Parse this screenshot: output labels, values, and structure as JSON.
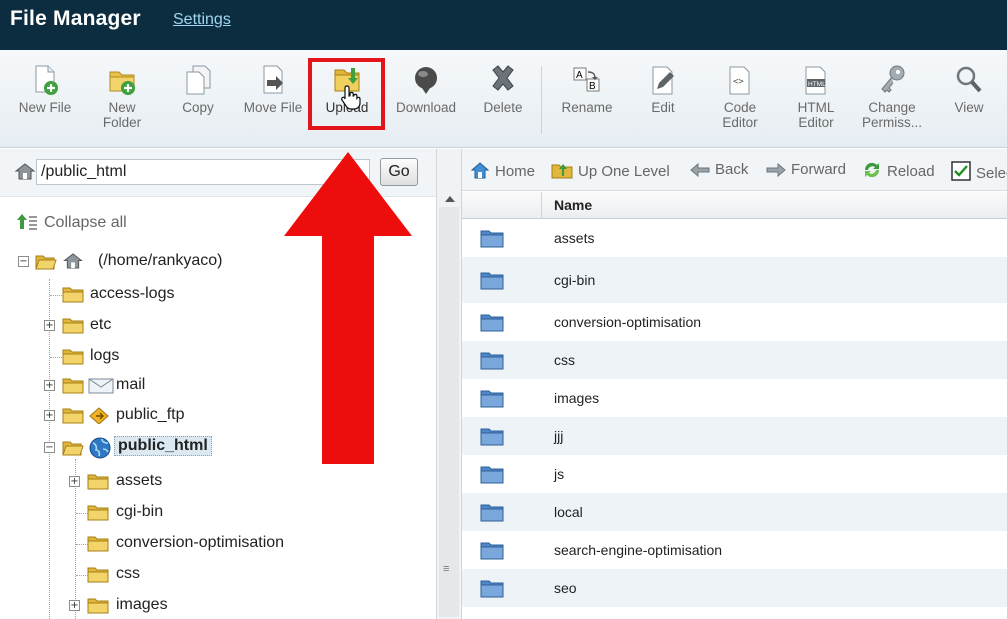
{
  "header": {
    "title": "File Manager",
    "settings_label": "Settings"
  },
  "toolbar": {
    "new_file": [
      "New File"
    ],
    "new_folder": [
      "New",
      "Folder"
    ],
    "copy": [
      "Copy"
    ],
    "move_file": [
      "Move File"
    ],
    "upload": [
      "Upload"
    ],
    "download": [
      "Download"
    ],
    "delete": [
      "Delete"
    ],
    "rename": [
      "Rename"
    ],
    "edit": [
      "Edit"
    ],
    "code_editor": [
      "Code",
      "Editor"
    ],
    "html_editor": [
      "HTML",
      "Editor"
    ],
    "change_permissions": [
      "Change",
      "Permiss..."
    ],
    "view": [
      "View"
    ]
  },
  "path_bar": {
    "value": "/public_html",
    "go_label": "Go"
  },
  "tree": {
    "collapse_label": "Collapse all",
    "root_label": "(/home/rankyaco)",
    "level1": [
      "access-logs",
      "etc",
      "logs",
      "mail",
      "public_ftp",
      "public_html"
    ],
    "level2": [
      "assets",
      "cgi-bin",
      "conversion-optimisation",
      "css",
      "images"
    ]
  },
  "nav": {
    "home": "Home",
    "up": "Up One Level",
    "back": "Back",
    "forward": "Forward",
    "reload": "Reload",
    "select": "Select all"
  },
  "file_list": {
    "name_header": "Name",
    "rows": [
      "assets",
      "cgi-bin",
      "conversion-optimisation",
      "css",
      "images",
      "jjj",
      "js",
      "local",
      "search-engine-optimisation",
      "seo"
    ]
  },
  "colors": {
    "header_bg": "#0c2d3f",
    "highlight": "#e4141b",
    "row_alt": "#eef3f8"
  },
  "icons": [
    "new-file-icon",
    "new-folder-icon",
    "copy-icon",
    "move-file-icon",
    "upload-icon",
    "download-icon",
    "delete-icon",
    "rename-icon",
    "edit-icon",
    "code-editor-icon",
    "html-editor-icon",
    "change-permissions-icon",
    "view-icon",
    "home-icon",
    "folder-icon",
    "globe-icon",
    "mail-icon",
    "ftp-icon",
    "hand-cursor-icon",
    "up-arrow-icon"
  ]
}
